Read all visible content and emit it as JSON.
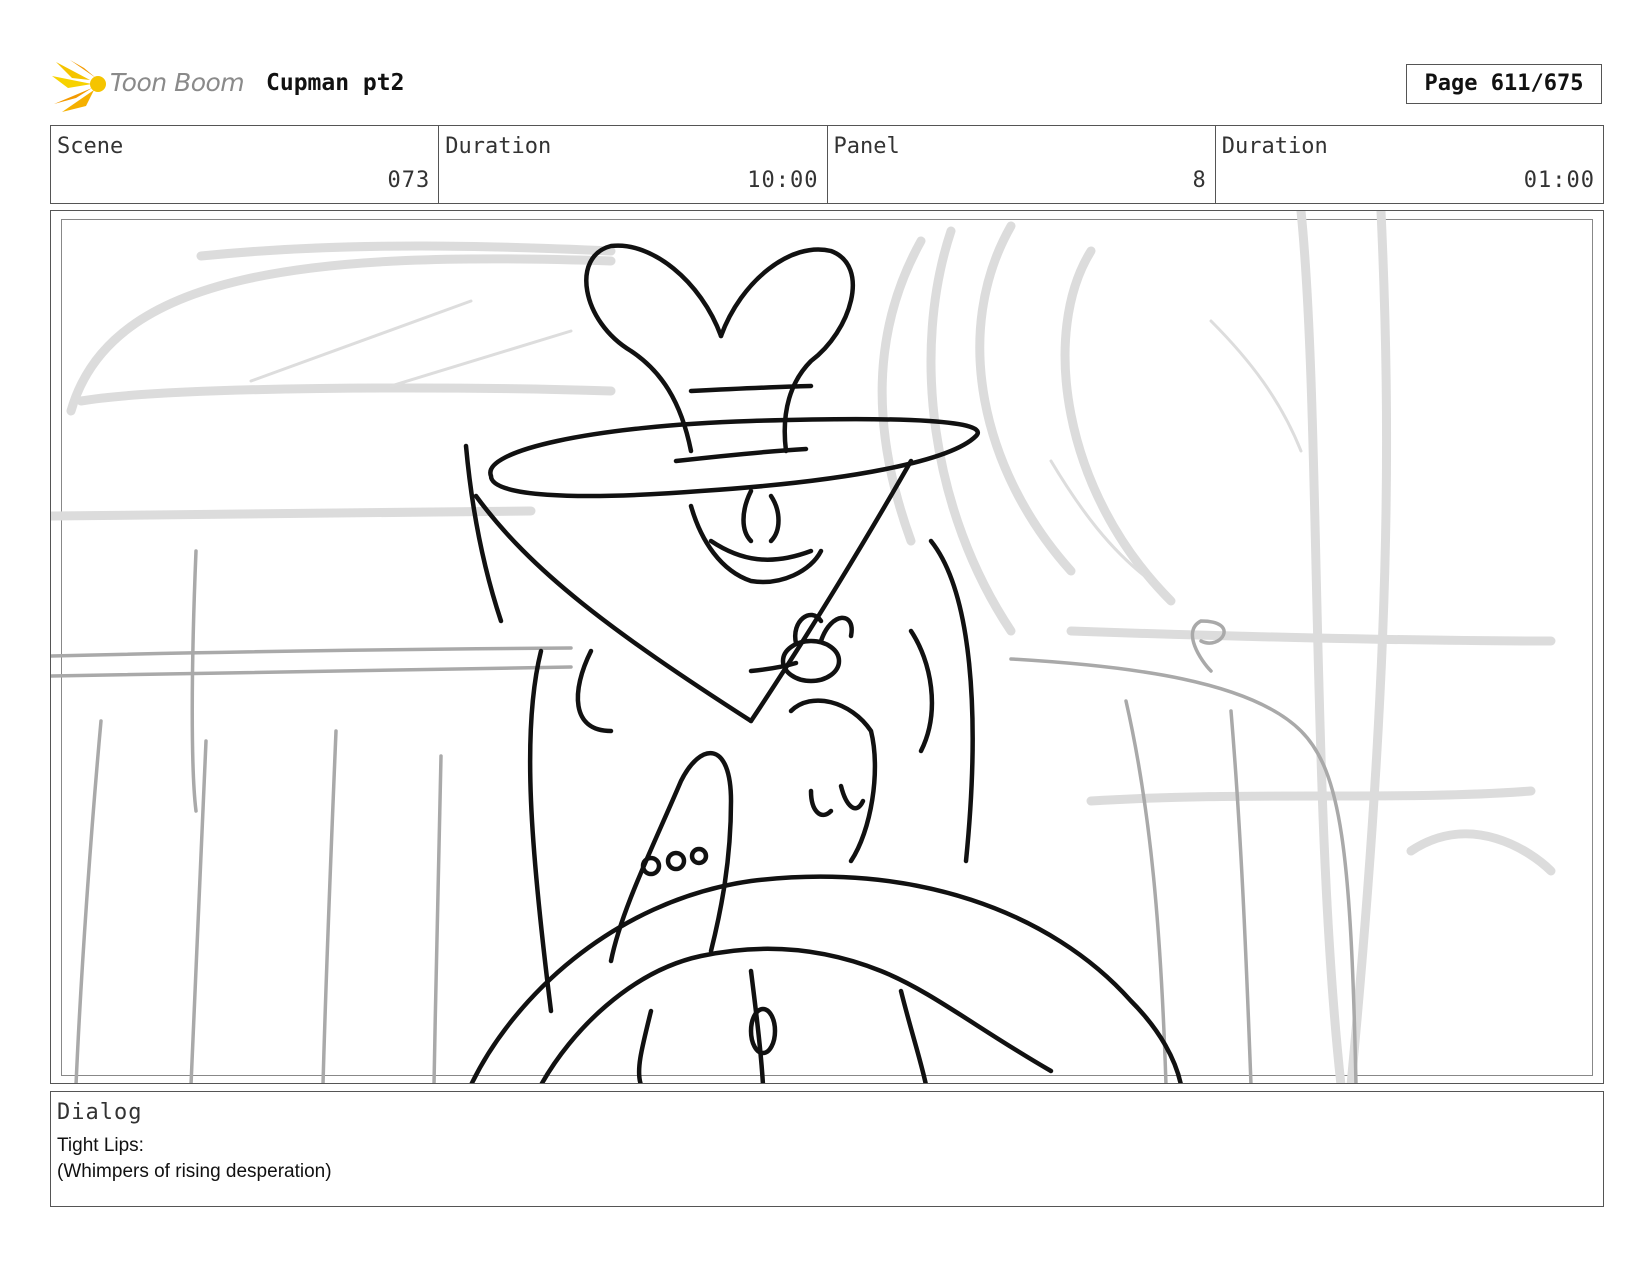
{
  "header": {
    "logo_text": "Toon Boom",
    "project_title": "Cupman pt2",
    "page_label": "Page 611/675"
  },
  "info": {
    "scene_label": "Scene",
    "scene_value": "073",
    "scene_duration_label": "Duration",
    "scene_duration_value": "10:00",
    "panel_label": "Panel",
    "panel_value": "8",
    "panel_duration_label": "Duration",
    "panel_duration_value": "01:00"
  },
  "dialog": {
    "label": "Dialog",
    "lines": [
      "Tight Lips:",
      "(Whimpers of rising desperation)"
    ]
  },
  "colors": {
    "logo_yellow": "#f5c400",
    "logo_orange": "#f39a00",
    "sketch_grey": "#d9d9d9",
    "ink": "#111111"
  },
  "icons": {
    "logo": "toon-boom-starburst-icon"
  }
}
